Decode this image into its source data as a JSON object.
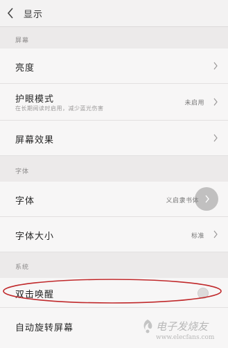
{
  "header": {
    "title": "显示",
    "back_icon": "chevron-left-icon"
  },
  "sections": [
    {
      "title": "屏幕",
      "items": [
        {
          "label": "亮度",
          "value": "",
          "sub": ""
        },
        {
          "label": "护眼模式",
          "value": "未启用",
          "sub": "在长期阅读时启用，减少蓝光伤害"
        },
        {
          "label": "屏幕效果",
          "value": "",
          "sub": ""
        }
      ]
    },
    {
      "title": "字体",
      "items": [
        {
          "label": "字体",
          "value": "义启隶书体",
          "sub": ""
        },
        {
          "label": "字体大小",
          "value": "标准",
          "sub": ""
        }
      ]
    },
    {
      "title": "系统",
      "items": [
        {
          "label": "双击唤醒",
          "value": "",
          "sub": "",
          "toggle": "off"
        },
        {
          "label": "自动旋转屏幕",
          "value": "",
          "sub": ""
        }
      ]
    }
  ],
  "watermark": {
    "text": "电子发烧友",
    "url": "www.elecfans.com"
  },
  "colors": {
    "annotation": "#c0282a",
    "background": "#eceaea",
    "row_background": "#f7f6f6"
  }
}
